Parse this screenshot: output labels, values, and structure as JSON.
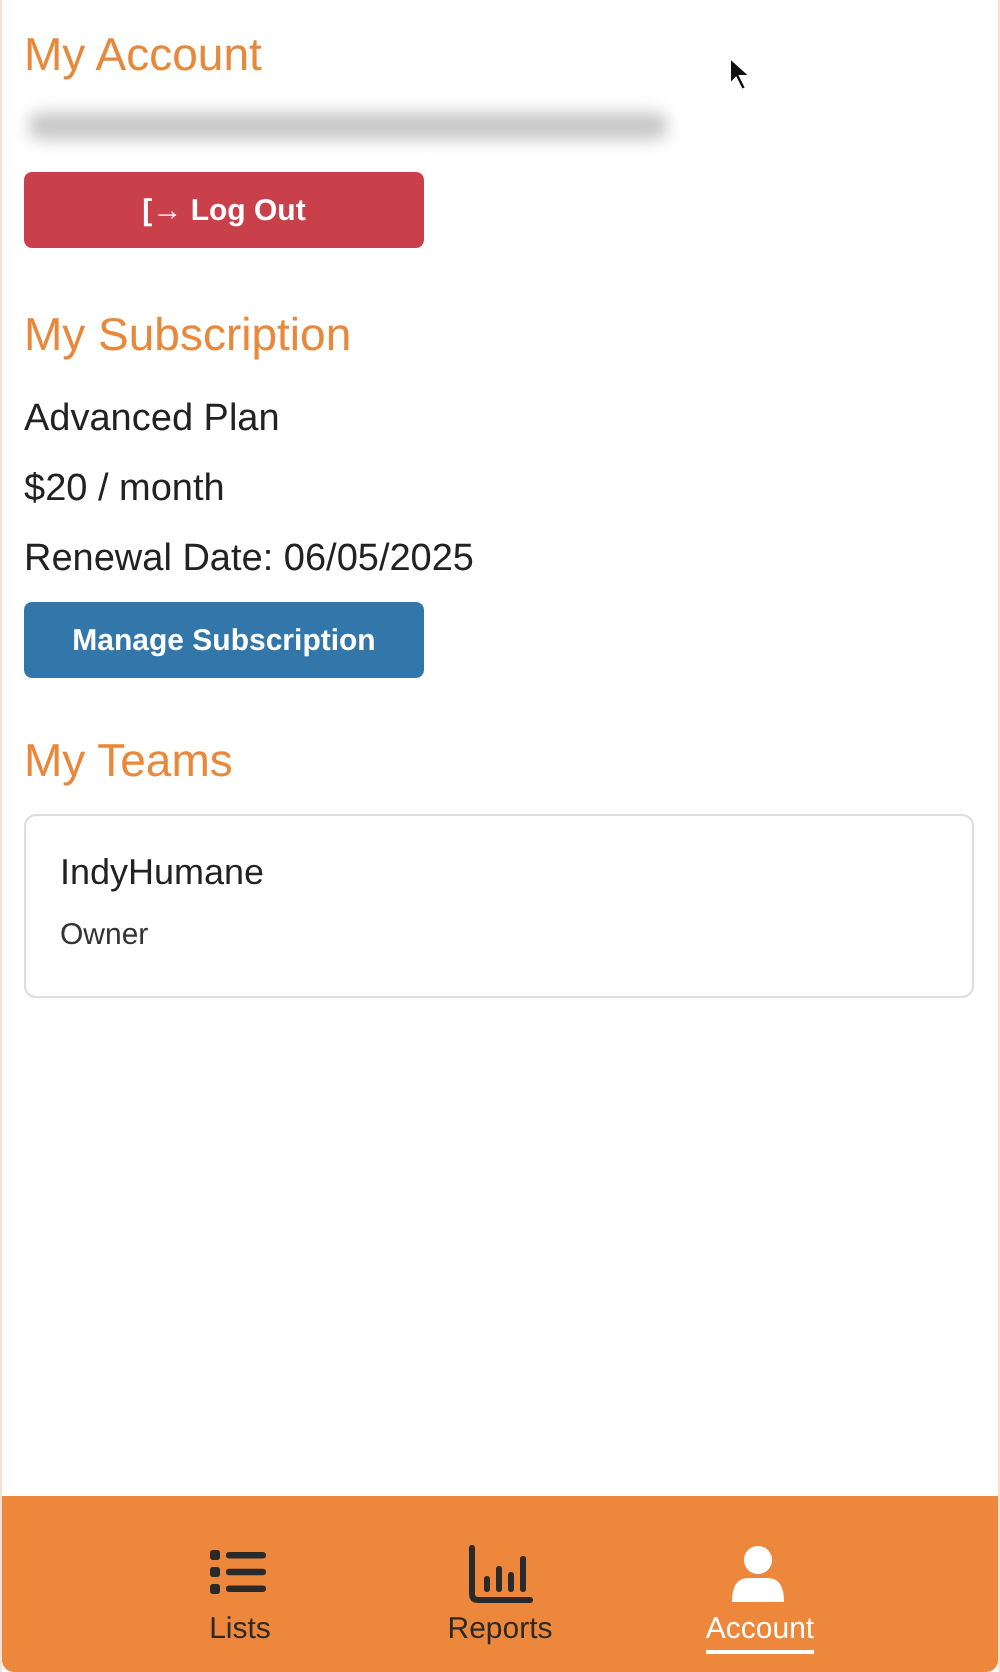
{
  "account": {
    "title": "My Account",
    "logout_button": {
      "icon": "[→",
      "label": "Log Out"
    }
  },
  "subscription": {
    "title": "My Subscription",
    "plan": "Advanced Plan",
    "price": "$20 / month",
    "renewal": "Renewal Date: 06/05/2025",
    "manage_button": "Manage Subscription"
  },
  "teams": {
    "title": "My Teams",
    "items": [
      {
        "name": "IndyHumane",
        "role": "Owner"
      }
    ]
  },
  "bottom_nav": [
    {
      "kind": "list",
      "label": "Lists",
      "selected": false
    },
    {
      "kind": "chart",
      "label": "Reports",
      "selected": false
    },
    {
      "kind": "person",
      "label": "Account",
      "selected": true
    }
  ]
}
